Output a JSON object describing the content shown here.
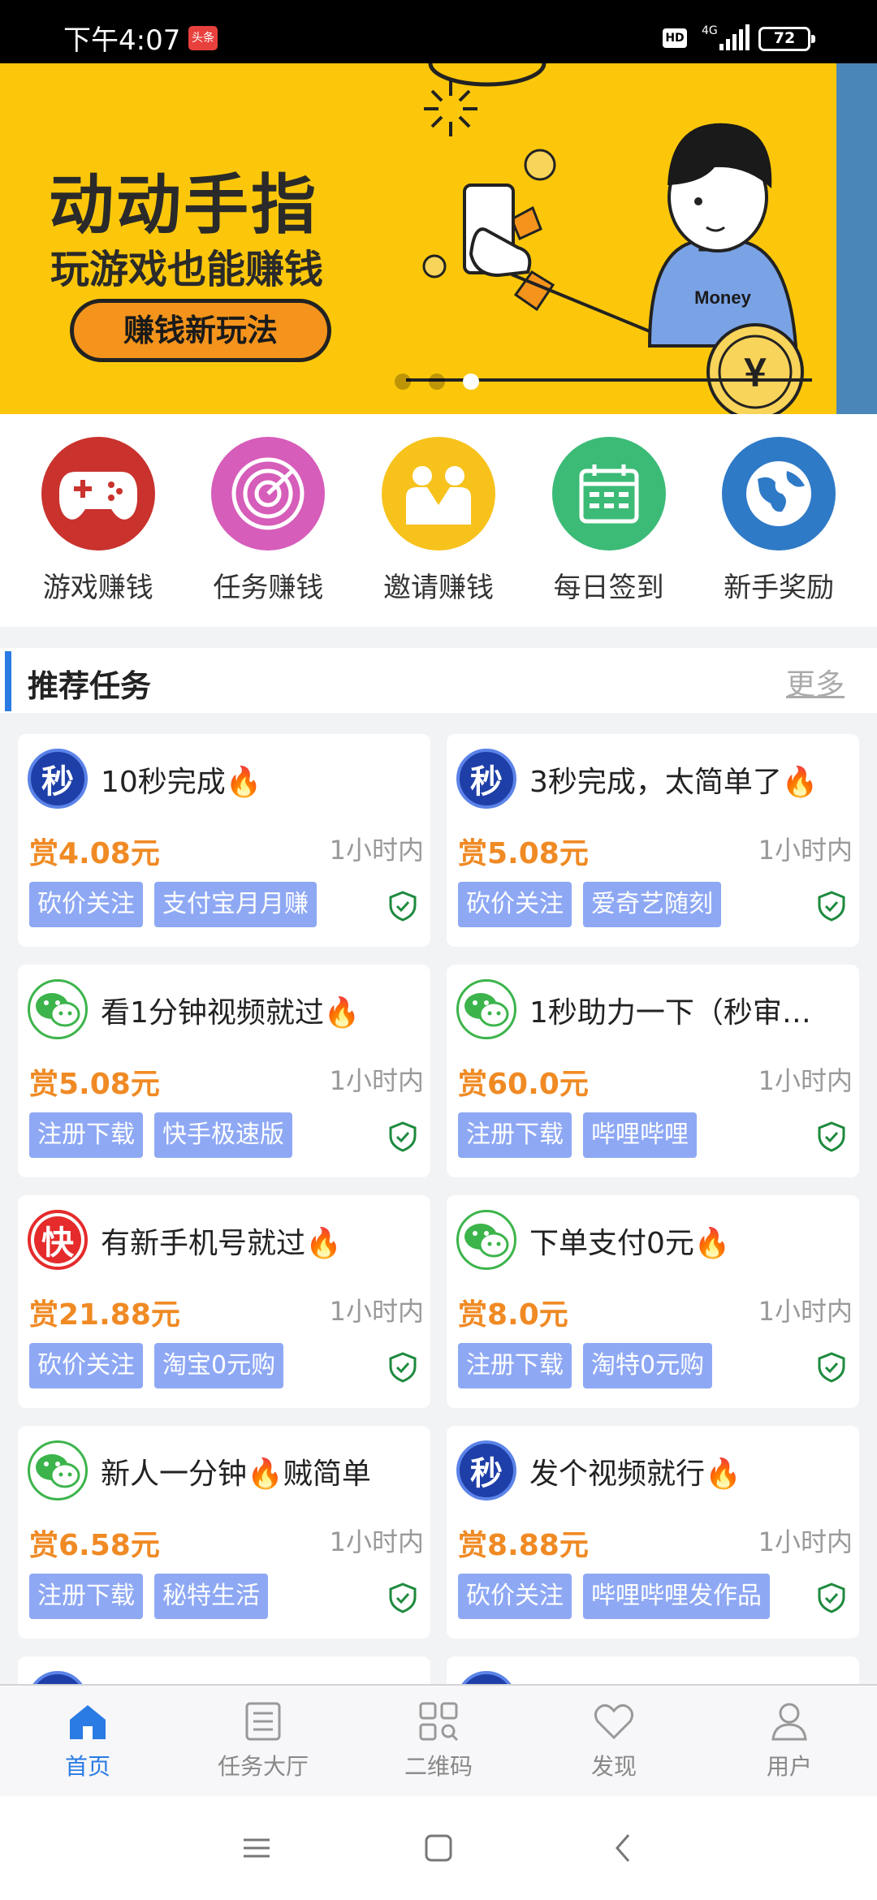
{
  "status_bar": {
    "time": "下午4:07",
    "news_badge": "头条",
    "hd": "HD",
    "network": "4G",
    "battery": "72"
  },
  "banner": {
    "headline": "动动手指",
    "subline": "玩游戏也能赚钱",
    "cta": "赚钱新玩法",
    "shirt_text": "Money",
    "coin_symbol": "¥",
    "active_dot": 3,
    "dot_count": 3
  },
  "categories": [
    {
      "label": "游戏赚钱",
      "icon": "gamepad-icon",
      "color": "#c9322d"
    },
    {
      "label": "任务赚钱",
      "icon": "radar-icon",
      "color": "#d65db9"
    },
    {
      "label": "邀请赚钱",
      "icon": "handshake-icon",
      "color": "#f7c21c"
    },
    {
      "label": "每日签到",
      "icon": "calendar-icon",
      "color": "#3cbb77"
    },
    {
      "label": "新手奖励",
      "icon": "globe-icon",
      "color": "#2e7ac7"
    }
  ],
  "section": {
    "title": "推荐任务",
    "more": "更多"
  },
  "tasks": [
    {
      "logo": "秒",
      "logo_type": "miao",
      "title": "10秒完成🔥",
      "reward": "赏4.08元",
      "time": "1小时内",
      "tags": [
        "砍价关注",
        "支付宝月月赚"
      ]
    },
    {
      "logo": "秒",
      "logo_type": "miao",
      "title": "3秒完成，太简单了🔥",
      "reward": "赏5.08元",
      "time": "1小时内",
      "tags": [
        "砍价关注",
        "爱奇艺随刻"
      ]
    },
    {
      "logo": "",
      "logo_type": "wechat",
      "title": "看1分钟视频就过🔥",
      "reward": "赏5.08元",
      "time": "1小时内",
      "tags": [
        "注册下载",
        "快手极速版"
      ]
    },
    {
      "logo": "",
      "logo_type": "wechat",
      "title": "1秒助力一下（秒审…",
      "reward": "赏60.0元",
      "time": "1小时内",
      "tags": [
        "注册下载",
        "哔哩哔哩"
      ]
    },
    {
      "logo": "快",
      "logo_type": "kuai",
      "title": "有新手机号就过🔥",
      "reward": "赏21.88元",
      "time": "1小时内",
      "tags": [
        "砍价关注",
        "淘宝0元购"
      ]
    },
    {
      "logo": "",
      "logo_type": "wechat",
      "title": "下单支付0元🔥",
      "reward": "赏8.0元",
      "time": "1小时内",
      "tags": [
        "注册下载",
        "淘特0元购"
      ]
    },
    {
      "logo": "",
      "logo_type": "wechat",
      "title": "新人一分钟🔥贼简单",
      "reward": "赏6.58元",
      "time": "1小时内",
      "tags": [
        "注册下载",
        "秘特生活"
      ]
    },
    {
      "logo": "秒",
      "logo_type": "miao",
      "title": "发个视频就行🔥",
      "reward": "赏8.88元",
      "time": "1小时内",
      "tags": [
        "砍价关注",
        "哔哩哔哩发作品"
      ]
    },
    {
      "logo": "",
      "logo_type": "miao",
      "title": "",
      "reward": "",
      "time": "",
      "tags": []
    },
    {
      "logo": "",
      "logo_type": "miao",
      "title": "",
      "reward": "",
      "time": "",
      "tags": []
    }
  ],
  "tabbar": [
    {
      "label": "首页",
      "icon": "home-icon",
      "active": true
    },
    {
      "label": "任务大厅",
      "icon": "list-icon",
      "active": false
    },
    {
      "label": "二维码",
      "icon": "qrcode-icon",
      "active": false
    },
    {
      "label": "发现",
      "icon": "heart-icon",
      "active": false
    },
    {
      "label": "用户",
      "icon": "user-icon",
      "active": false
    }
  ],
  "colors": {
    "accent": "#2a7be4",
    "reward": "#f08a24",
    "tag_bg": "#8ea8f4",
    "banner_bg": "#fcc70a",
    "verified": "#1e8a3e"
  }
}
